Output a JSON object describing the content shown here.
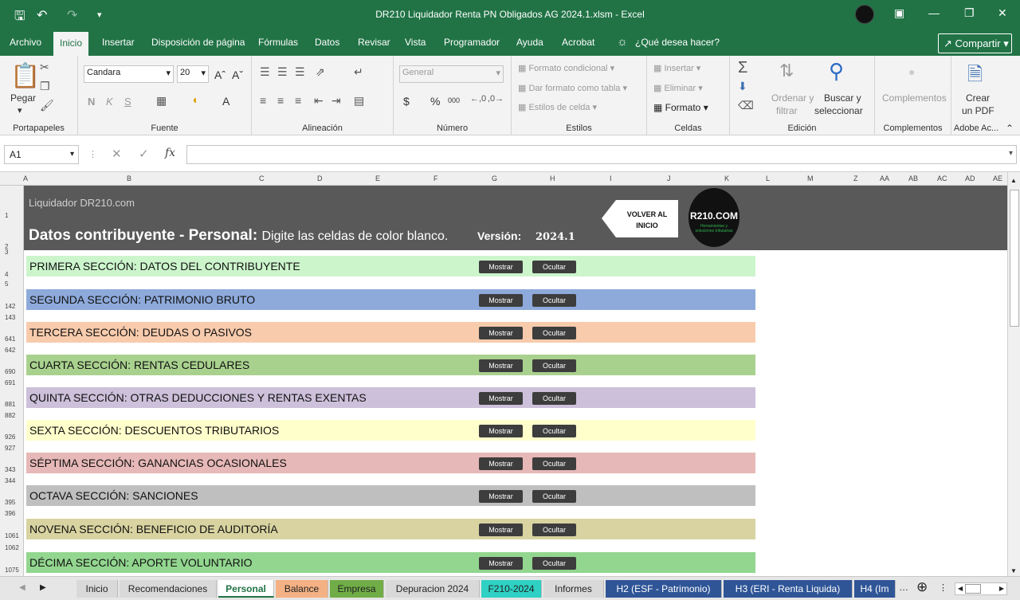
{
  "window": {
    "title": "DR210 Liquidador Renta PN Obligados AG 2024.1.xlsm  -  Excel"
  },
  "menu": {
    "items": [
      "Archivo",
      "Inicio",
      "Insertar",
      "Disposición de página",
      "Fórmulas",
      "Datos",
      "Revisar",
      "Vista",
      "Programador",
      "Ayuda",
      "Acrobat"
    ],
    "search": "¿Qué desea hacer?",
    "share": "Compartir"
  },
  "ribbon": {
    "clipboard": {
      "paste": "Pegar",
      "label": "Portapapeles"
    },
    "font": {
      "name": "Candara",
      "size": "20",
      "bold": "N",
      "italic": "K",
      "strike": "S",
      "label": "Fuente"
    },
    "alignment": {
      "label": "Alineación"
    },
    "number": {
      "format": "General",
      "label": "Número",
      "currency": "$",
      "percent": "%",
      "thousands": "000"
    },
    "styles": {
      "conditional": "Formato condicional",
      "table": "Dar formato como tabla",
      "cell": "Estilos de celda",
      "label": "Estilos"
    },
    "cells": {
      "insert": "Insertar",
      "delete": "Eliminar",
      "format": "Formato",
      "label": "Celdas"
    },
    "editing": {
      "sort1": "Ordenar y",
      "sort2": "filtrar",
      "find1": "Buscar y",
      "find2": "seleccionar",
      "label": "Edición"
    },
    "addins": {
      "btn": "Complementos",
      "label": "Complementos"
    },
    "adobe": {
      "btn1": "Crear",
      "btn2": "un PDF",
      "label": "Adobe Ac..."
    }
  },
  "formula_bar": {
    "name_box": "A1",
    "fx": "fx",
    "value": ""
  },
  "columns": [
    "A",
    "B",
    "C",
    "D",
    "E",
    "F",
    "G",
    "H",
    "I",
    "J",
    "K",
    "L",
    "M",
    "Z",
    "AA",
    "AB",
    "AC",
    "AD",
    "AE"
  ],
  "rows": [
    "1",
    "2",
    "3",
    "4",
    "5",
    "142",
    "143",
    "641",
    "642",
    "690",
    "691",
    "881",
    "882",
    "926",
    "927",
    "343",
    "344",
    "395",
    "396",
    "1061",
    "1062",
    "1075"
  ],
  "sheet": {
    "subtitle": "Liquidador DR210.com",
    "title": "Datos contribuyente - Personal:",
    "instruction": "Digite las celdas de color blanco.",
    "version_label": "Versión:",
    "version": "2024.1",
    "back_button": "VOLVER AL INICIO",
    "logo_text": "R210.COM",
    "logo_sub": "Herramientas y soluciones tributarias",
    "show_label": "Mostrar",
    "hide_label": "Ocultar",
    "sections": [
      {
        "label": "PRIMERA SECCIÓN: DATOS DEL CONTRIBUYENTE",
        "color": "#ccf5cc"
      },
      {
        "label": "SEGUNDA SECCIÓN: PATRIMONIO BRUTO",
        "color": "#8eaadb"
      },
      {
        "label": "TERCERA SECCIÓN: DEUDAS O PASIVOS",
        "color": "#f8cbad"
      },
      {
        "label": "CUARTA SECCIÓN: RENTAS CEDULARES",
        "color": "#a9d18e"
      },
      {
        "label": "QUINTA SECCIÓN: OTRAS DEDUCCIONES Y RENTAS EXENTAS",
        "color": "#ccc0da"
      },
      {
        "label": "SEXTA SECCIÓN: DESCUENTOS TRIBUTARIOS",
        "color": "#ffffcc"
      },
      {
        "label": "SÉPTIMA SECCIÓN: GANANCIAS OCASIONALES",
        "color": "#e6b8b7"
      },
      {
        "label": "OCTAVA SECCIÓN: SANCIONES",
        "color": "#bfbfbf"
      },
      {
        "label": "NOVENA SECCIÓN: BENEFICIO DE AUDITORÍA",
        "color": "#d8d3a0"
      },
      {
        "label": "DÉCIMA SECCIÓN: APORTE VOLUNTARIO",
        "color": "#92d68f"
      }
    ]
  },
  "tabs": [
    {
      "label": "Inicio",
      "color": "#d9d9d9"
    },
    {
      "label": "Recomendaciones",
      "color": "#d9d9d9"
    },
    {
      "label": "Personal",
      "color": "#ffffff"
    },
    {
      "label": "Balance",
      "color": "#f4b183"
    },
    {
      "label": "Empresa",
      "color": "#70ad47"
    },
    {
      "label": "Depuracion 2024",
      "color": "#d9d9d9"
    },
    {
      "label": "F210-2024",
      "color": "#2ed1c4"
    },
    {
      "label": "Informes",
      "color": "#d9d9d9"
    },
    {
      "label": "H2 (ESF - Patrimonio)",
      "color": "#2f5597"
    },
    {
      "label": "H3 (ERI - Renta Liquida)",
      "color": "#2f5597"
    },
    {
      "label": "H4 (Im",
      "color": "#2f5597"
    }
  ]
}
